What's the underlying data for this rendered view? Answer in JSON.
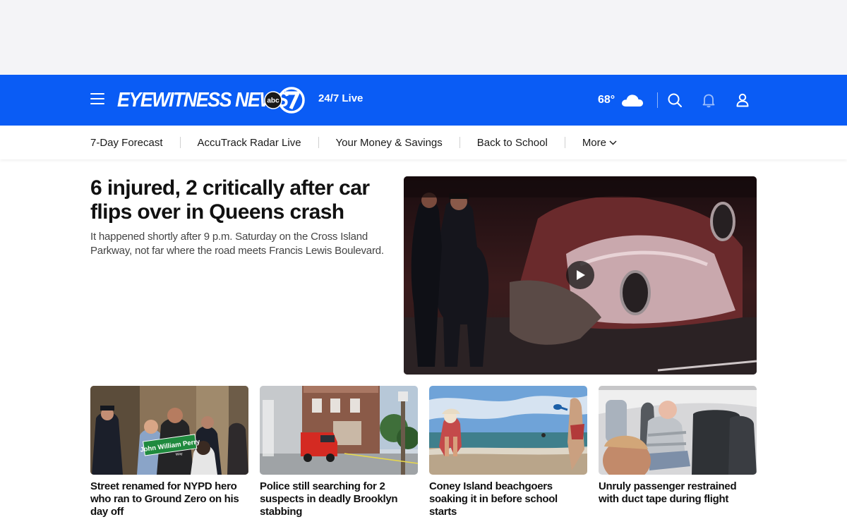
{
  "header": {
    "brand": "EYEWITNESS NEWS",
    "brand_badge": "abc",
    "channel_number": "7",
    "live_label": "24/7 Live",
    "brand_color": "#0a5cf5",
    "weather": {
      "temperature": "68°",
      "condition_icon": "cloud-icon"
    },
    "icons": [
      "menu-icon",
      "search-icon",
      "bell-icon",
      "user-icon"
    ]
  },
  "nav": {
    "items": [
      "7-Day Forecast",
      "AccuTrack Radar Live",
      "Your Money & Savings",
      "Back to School"
    ],
    "more_label": "More"
  },
  "hero": {
    "headline": "6 injured, 2 critically after car flips over in Queens crash",
    "description": "It happened shortly after 9 p.m. Saturday on the Cross Island Parkway, not far where the road meets Francis Lewis Boulevard.",
    "media_type": "video",
    "play_icon": "play-icon"
  },
  "stories": [
    {
      "title": "Street renamed for NYPD hero who ran to Ground Zero on his day off",
      "sign_text": "John William Perry",
      "sign_subtext": "Way"
    },
    {
      "title": "Police still searching for 2 suspects in deadly Brooklyn stabbing"
    },
    {
      "title": "Coney Island beachgoers soaking it in before school starts"
    },
    {
      "title": "Unruly passenger restrained with duct tape during flight"
    }
  ]
}
